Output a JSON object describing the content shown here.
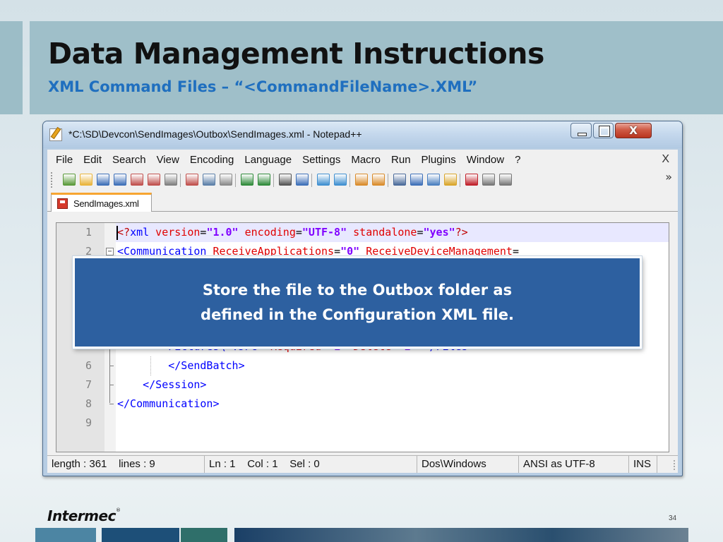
{
  "slide": {
    "title": "Data Management Instructions",
    "subtitle": "XML Command Files – “<CommandFileName>.XML”",
    "page_number": "34",
    "logo_text": "Intermec"
  },
  "window": {
    "title": "*C:\\SD\\Devcon\\SendImages\\Outbox\\SendImages.xml - Notepad++",
    "close_glyph": "X"
  },
  "menu": {
    "items": [
      "File",
      "Edit",
      "Search",
      "View",
      "Encoding",
      "Language",
      "Settings",
      "Macro",
      "Run",
      "Plugins",
      "Window",
      "?"
    ],
    "close_doc": "X"
  },
  "toolbar": {
    "overflow": "»",
    "icons": [
      "new-file-icon",
      "open-file-icon",
      "save-icon",
      "save-all-icon",
      "close-icon",
      "close-all-icon",
      "print-icon",
      "cut-icon",
      "copy-icon",
      "paste-icon",
      "undo-icon",
      "redo-icon",
      "find-icon",
      "replace-icon",
      "zoom-in-icon",
      "zoom-out-icon",
      "sync-vertical-icon",
      "sync-horizontal-icon",
      "word-wrap-icon",
      "show-all-characters-icon",
      "indent-guide-icon",
      "user-language-icon",
      "record-macro-icon",
      "stop-macro-icon",
      "play-macro-icon"
    ]
  },
  "tab": {
    "label": "SendImages.xml"
  },
  "editor": {
    "lines": [
      {
        "no": "1",
        "html_tokens": [
          [
            "t-decl",
            "<?"
          ],
          [
            "t-tag",
            "xml"
          ],
          [
            "t-attr",
            " version"
          ],
          [
            "t-eq",
            "="
          ],
          [
            "t-str",
            "\"1.0\""
          ],
          [
            "t-attr",
            " encoding"
          ],
          [
            "t-eq",
            "="
          ],
          [
            "t-str",
            "\"UTF-8\""
          ],
          [
            "t-attr",
            " standalone"
          ],
          [
            "t-eq",
            "="
          ],
          [
            "t-str",
            "\"yes\""
          ],
          [
            "t-decl",
            "?>"
          ]
        ]
      },
      {
        "no": "2",
        "html_tokens": [
          [
            "t-tag",
            "<Communication"
          ],
          [
            "t-attr",
            " ReceiveApplications"
          ],
          [
            "t-eq",
            "="
          ],
          [
            "t-str",
            "\"0\""
          ],
          [
            "t-attr",
            " ReceiveDeviceManagement"
          ],
          [
            "t-eq",
            "="
          ]
        ]
      },
      {
        "no": "",
        "html_tokens": [
          [
            "t-tag",
            "        Pictures\\*.JPG\""
          ],
          [
            "t-attr",
            " Required"
          ],
          [
            "t-eq",
            "="
          ],
          [
            "t-str",
            "\"1\""
          ],
          [
            "t-attr",
            " Delete"
          ],
          [
            "t-eq",
            "="
          ],
          [
            "t-str",
            "\"1\""
          ],
          [
            "t-tag",
            "></Files>"
          ]
        ]
      },
      {
        "no": "6",
        "html_tokens": [
          [
            "t-tag",
            "        </SendBatch>"
          ]
        ]
      },
      {
        "no": "7",
        "html_tokens": [
          [
            "t-tag",
            "    </Session>"
          ]
        ]
      },
      {
        "no": "8",
        "html_tokens": [
          [
            "t-tag",
            "</Communication>"
          ]
        ]
      },
      {
        "no": "9",
        "html_tokens": []
      }
    ]
  },
  "statusbar": {
    "length": "length : 361    lines : 9",
    "position": "Ln : 1    Col : 1    Sel : 0",
    "eol": "Dos\\Windows",
    "encoding": "ANSI as UTF-8",
    "mode": "INS"
  },
  "callout": {
    "line1": "Store the file to the Outbox folder as",
    "line2": "defined in the Configuration XML file."
  },
  "colors": {
    "header_band": "#9fbfc9",
    "subtitle": "#1f6fbf",
    "callout_bg": "#2d60a0",
    "tab_accent": "#f7a531"
  }
}
